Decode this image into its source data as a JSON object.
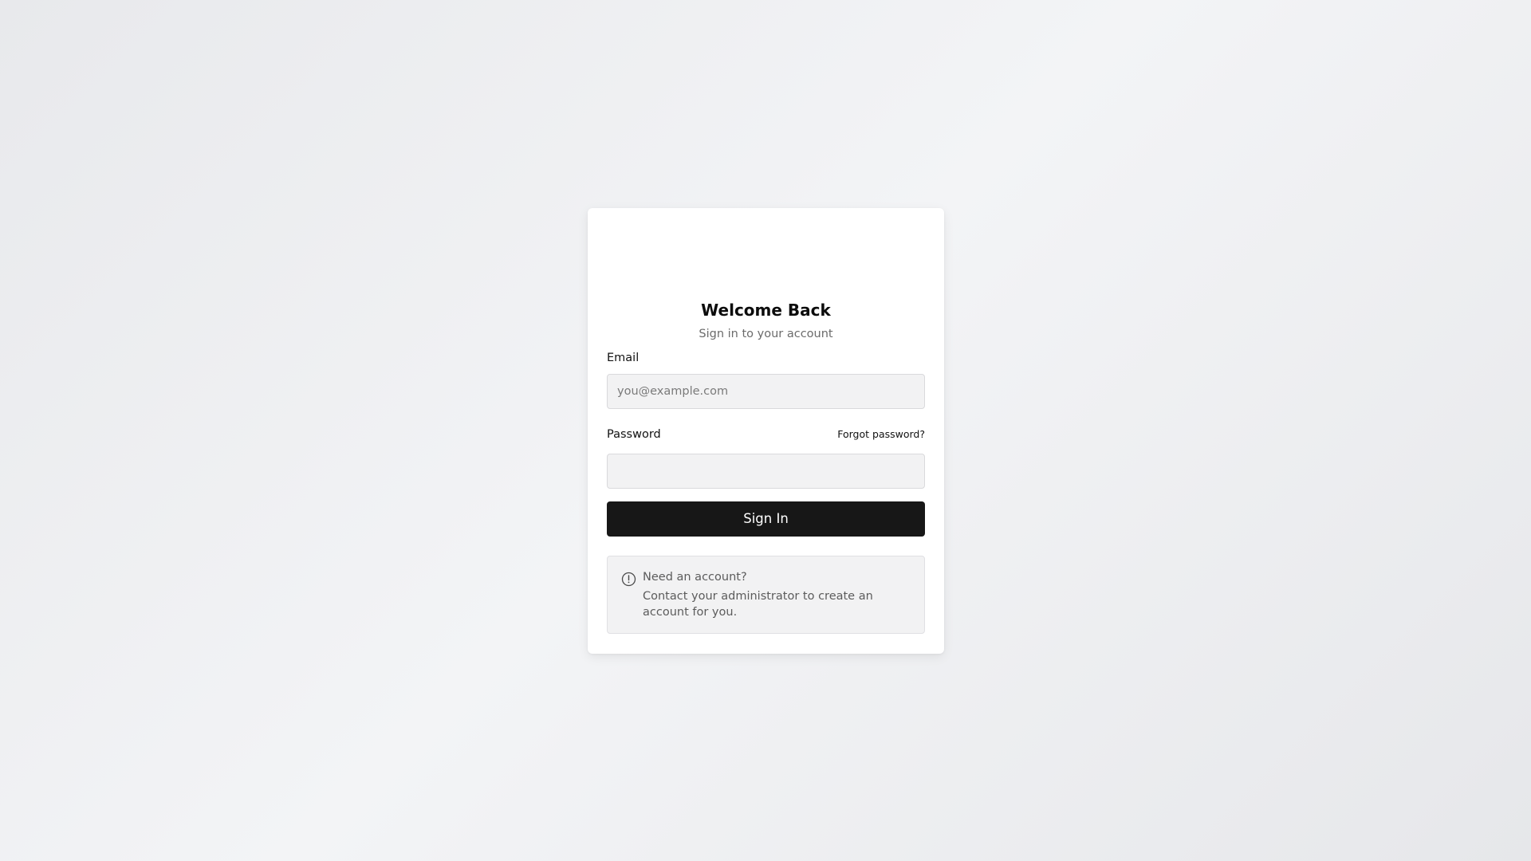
{
  "login": {
    "title": "Welcome Back",
    "subtitle": "Sign in to your account",
    "email_label": "Email",
    "email_placeholder": "you@example.com",
    "email_value": "",
    "password_label": "Password",
    "password_value": "",
    "forgot_label": "Forgot password?",
    "submit_label": "Sign In"
  },
  "info": {
    "icon": "alert-circle-icon",
    "title": "Need an account?",
    "text": "Contact your administrator to create an account for you."
  },
  "colors": {
    "button_bg": "#171717",
    "button_text": "#ffffff",
    "input_bg": "#f2f2f3",
    "muted_text": "#6b6b6b"
  }
}
